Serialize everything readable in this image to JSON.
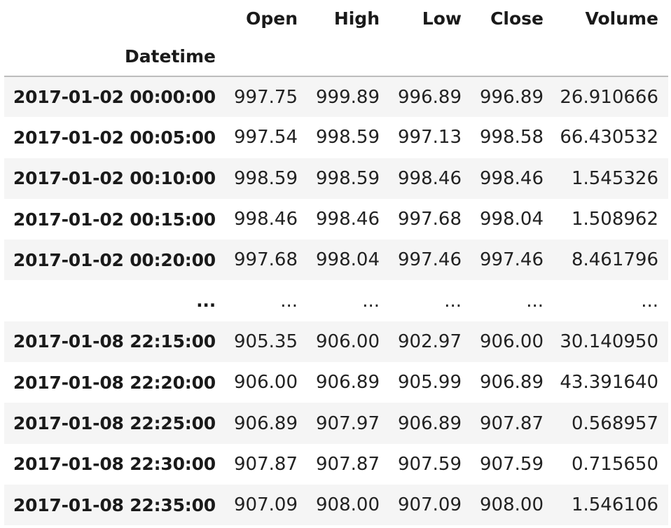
{
  "table": {
    "columns": [
      "Open",
      "High",
      "Low",
      "Close",
      "Volume"
    ],
    "index_name": "Datetime",
    "rows": [
      {
        "index": "2017-01-02 00:00:00",
        "values": [
          "997.75",
          "999.89",
          "996.89",
          "996.89",
          "26.910666"
        ]
      },
      {
        "index": "2017-01-02 00:05:00",
        "values": [
          "997.54",
          "998.59",
          "997.13",
          "998.58",
          "66.430532"
        ]
      },
      {
        "index": "2017-01-02 00:10:00",
        "values": [
          "998.59",
          "998.59",
          "998.46",
          "998.46",
          "1.545326"
        ]
      },
      {
        "index": "2017-01-02 00:15:00",
        "values": [
          "998.46",
          "998.46",
          "997.68",
          "998.04",
          "1.508962"
        ]
      },
      {
        "index": "2017-01-02 00:20:00",
        "values": [
          "997.68",
          "998.04",
          "997.46",
          "997.46",
          "8.461796"
        ]
      },
      {
        "index": "...",
        "values": [
          "...",
          "...",
          "...",
          "...",
          "..."
        ]
      },
      {
        "index": "2017-01-08 22:15:00",
        "values": [
          "905.35",
          "906.00",
          "902.97",
          "906.00",
          "30.140950"
        ]
      },
      {
        "index": "2017-01-08 22:20:00",
        "values": [
          "906.00",
          "906.89",
          "905.99",
          "906.89",
          "43.391640"
        ]
      },
      {
        "index": "2017-01-08 22:25:00",
        "values": [
          "906.89",
          "907.97",
          "906.89",
          "907.87",
          "0.568957"
        ]
      },
      {
        "index": "2017-01-08 22:30:00",
        "values": [
          "907.87",
          "907.87",
          "907.59",
          "907.59",
          "0.715650"
        ]
      },
      {
        "index": "2017-01-08 22:35:00",
        "values": [
          "907.09",
          "908.00",
          "907.09",
          "908.00",
          "1.546106"
        ]
      }
    ]
  }
}
